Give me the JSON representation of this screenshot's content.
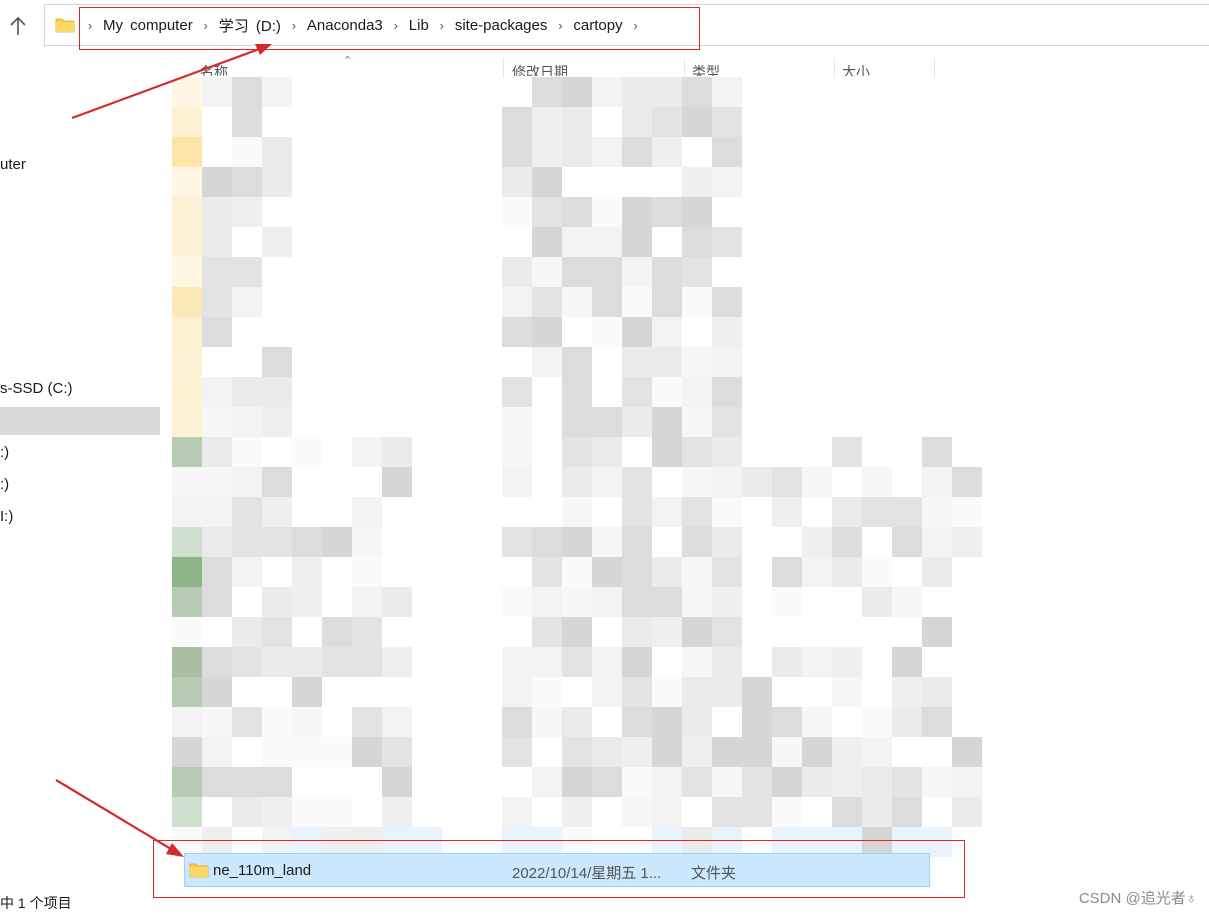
{
  "address_bar": {
    "folder_icon": "folder-icon",
    "breadcrumb": [
      "My  computer",
      "学习 (D:)",
      "Anaconda3",
      "Lib",
      "site-packages",
      "cartopy"
    ]
  },
  "nav_pane": {
    "items": [
      "uter",
      "s-SSD (C:)",
      ":)",
      ":)",
      "I:)"
    ]
  },
  "columns": [
    "名称",
    "修改日期",
    "类型",
    "大小"
  ],
  "selected_item": {
    "icon": "folder-icon",
    "name": "ne_110m_land",
    "date": "2022/10/14/星期五 1...",
    "type": "文件夹"
  },
  "status_bar": {
    "text": "中 1 个项目"
  },
  "watermark": "CSDN @追光者♁",
  "colors": {
    "selection_bg": "#cce8ff",
    "selection_border": "#99d1ff",
    "annotation_red": "#d42a2a",
    "folder_yellow": "#ffc83d"
  }
}
